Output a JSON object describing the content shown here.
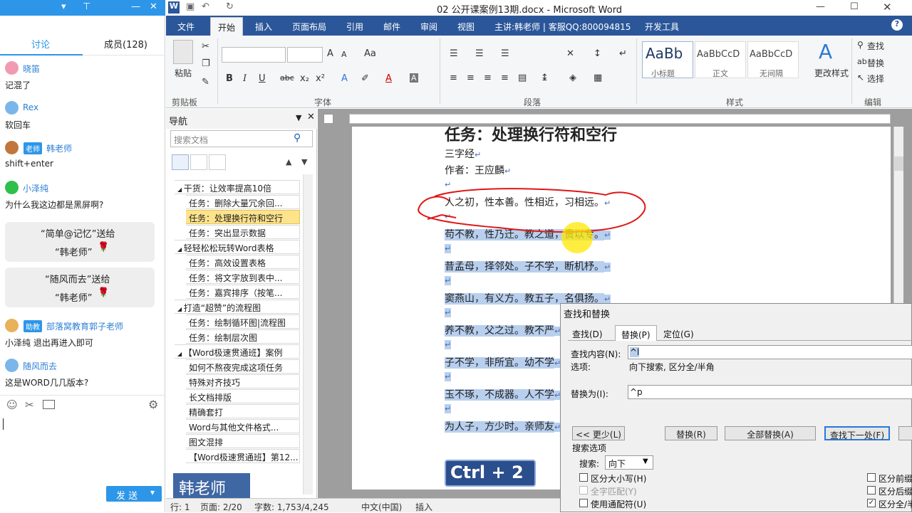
{
  "chat": {
    "tabs": [
      "讨论",
      "成员(128)"
    ],
    "messages": [
      {
        "name": "晓笛",
        "text": "记混了"
      },
      {
        "name": "Rex",
        "text": "软回车"
      },
      {
        "badge": "老师",
        "name": "韩老师",
        "text": "shift+enter"
      },
      {
        "name": "小泽纯",
        "text": "为什么我这边都是黑屏啊?"
      },
      {
        "badge": "助教",
        "name": "部落窝教育郭子老师",
        "text": "小泽纯 退出再进入即可"
      },
      {
        "name": "随风而去",
        "text": "这是WORD几几版本?"
      }
    ],
    "gifts": [
      {
        "line1": "“简单@记忆”送给",
        "line2": "“韩老师”"
      },
      {
        "line1": "“随风而去”送给",
        "line2": "“韩老师”"
      }
    ],
    "send_label": "发 送",
    "rose": "🌹"
  },
  "word": {
    "title": "02 公开课案例13期.docx - Microsoft Word",
    "tabs": [
      "文件",
      "开始",
      "插入",
      "页面布局",
      "引用",
      "邮件",
      "审阅",
      "视图",
      "主讲:韩老师 | 客服QQ:800094815",
      "开发工具"
    ],
    "groups": [
      "剪贴板",
      "字体",
      "段落",
      "样式",
      "编辑"
    ],
    "paste_label": "粘贴",
    "styles": [
      {
        "sample": "AaBb",
        "name": "小标题"
      },
      {
        "sample": "AaBbCcD",
        "name": "正文"
      },
      {
        "sample": "AaBbCcD",
        "name": "无间隔"
      }
    ],
    "change_style": "更改样式",
    "editing": [
      "查找",
      "替换",
      "选择"
    ]
  },
  "nav": {
    "title": "导航",
    "search_placeholder": "搜索文档",
    "items": [
      {
        "level": 1,
        "text": "干货：让效率提高10倍"
      },
      {
        "level": 2,
        "text": "任务：删除大量冗余回..."
      },
      {
        "level": 2,
        "text": "任务：处理换行符和空行",
        "selected": true
      },
      {
        "level": 2,
        "text": "任务：突出显示数据"
      },
      {
        "level": 1,
        "text": "轻轻松松玩转Word表格"
      },
      {
        "level": 2,
        "text": "任务：高效设置表格"
      },
      {
        "level": 2,
        "text": "任务：将文字放到表中..."
      },
      {
        "level": 2,
        "text": "任务：嘉宾排序（按笔..."
      },
      {
        "level": 1,
        "text": "打造“超赞”的流程图"
      },
      {
        "level": 2,
        "text": "任务：绘制循环图|流程图"
      },
      {
        "level": 2,
        "text": "任务：绘制层次图"
      },
      {
        "level": 1,
        "text": "【Word极速贯通班】案例"
      },
      {
        "level": 2,
        "text": "如何不熬夜完成这项任务"
      },
      {
        "level": 2,
        "text": "特殊对齐技巧"
      },
      {
        "level": 2,
        "text": "长文档排版"
      },
      {
        "level": 2,
        "text": "精确套打"
      },
      {
        "level": 2,
        "text": "Word与其他文件格式..."
      },
      {
        "level": 2,
        "text": "图文混排"
      },
      {
        "level": 2,
        "text": "【Word极速贯通班】第12..."
      }
    ]
  },
  "doc": {
    "heading": "任务：处理换行符和空行",
    "lines": [
      "三字经",
      "作者：王应麟",
      "",
      "人之初，性本善。性相近，习相远。",
      "",
      "苟不教，性乃迁。教之道，贵以专。",
      "",
      "昔孟母，择邻处。子不学，断机杼。",
      "",
      "窦燕山，有义方。教五子，名俱扬。",
      "",
      "养不教，父之过。教不严",
      "",
      "子不学，非所宜。幼不学",
      "",
      "玉不琢，不成器。人不学",
      "",
      "为人子，方少时。亲师友"
    ],
    "para_mark": "↵"
  },
  "dialog": {
    "title": "查找和替换",
    "tabs": [
      "查找(D)",
      "替换(P)",
      "定位(G)"
    ],
    "find_label": "查找内容(N):",
    "find_value": "^l",
    "options_label": "选项:",
    "options_value": "向下搜索, 区分全/半角",
    "replace_label": "替换为(I):",
    "replace_value": "^p",
    "buttons": [
      "<< 更少(L)",
      "替换(R)",
      "全部替换(A)",
      "查找下一处(F)"
    ],
    "search_options": "搜索选项",
    "search_label": "搜索:",
    "search_value": "向下",
    "checks_left": [
      "区分大小写(H)",
      "全字匹配(Y)",
      "使用通配符(U)"
    ],
    "checks_right": [
      "区分前缀",
      "区分后缀",
      "区分全/半"
    ]
  },
  "status": {
    "items": [
      "行: 1",
      "页面: 2/20",
      "字数: 1,753/4,245",
      "中文(中国)",
      "插入"
    ]
  },
  "overlays": {
    "watermark": "韩老师",
    "shortcut": "Ctrl + 2"
  }
}
